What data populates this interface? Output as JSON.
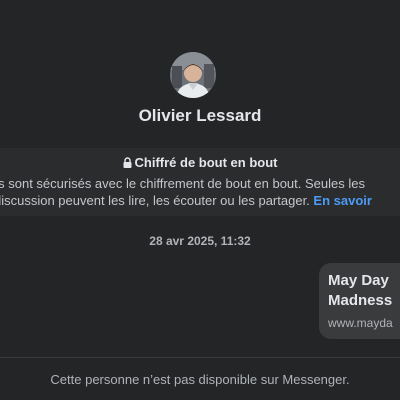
{
  "contact": {
    "name": "Olivier Lessard"
  },
  "encryption": {
    "title": "Chiffré de bout en bout",
    "line1": "els sont sécurisés avec le chiffrement de bout en bout. Seules les",
    "line2": "discussion peuvent les lire, les écouter ou les partager.",
    "learn_more": "En savoir"
  },
  "timestamp": "28 avr 2025, 11:32",
  "link_preview": {
    "title": "May Day Madness",
    "url": "www.mayda"
  },
  "footer": {
    "unavailable_notice": "Cette personne n’est pas disponible sur Messenger."
  },
  "colors": {
    "background": "#242526",
    "banner": "#2b2c2e",
    "bubble": "#3a3b3c",
    "text_primary": "#e4e6eb",
    "text_secondary": "#b0b3b8",
    "link": "#4c9bf5"
  }
}
